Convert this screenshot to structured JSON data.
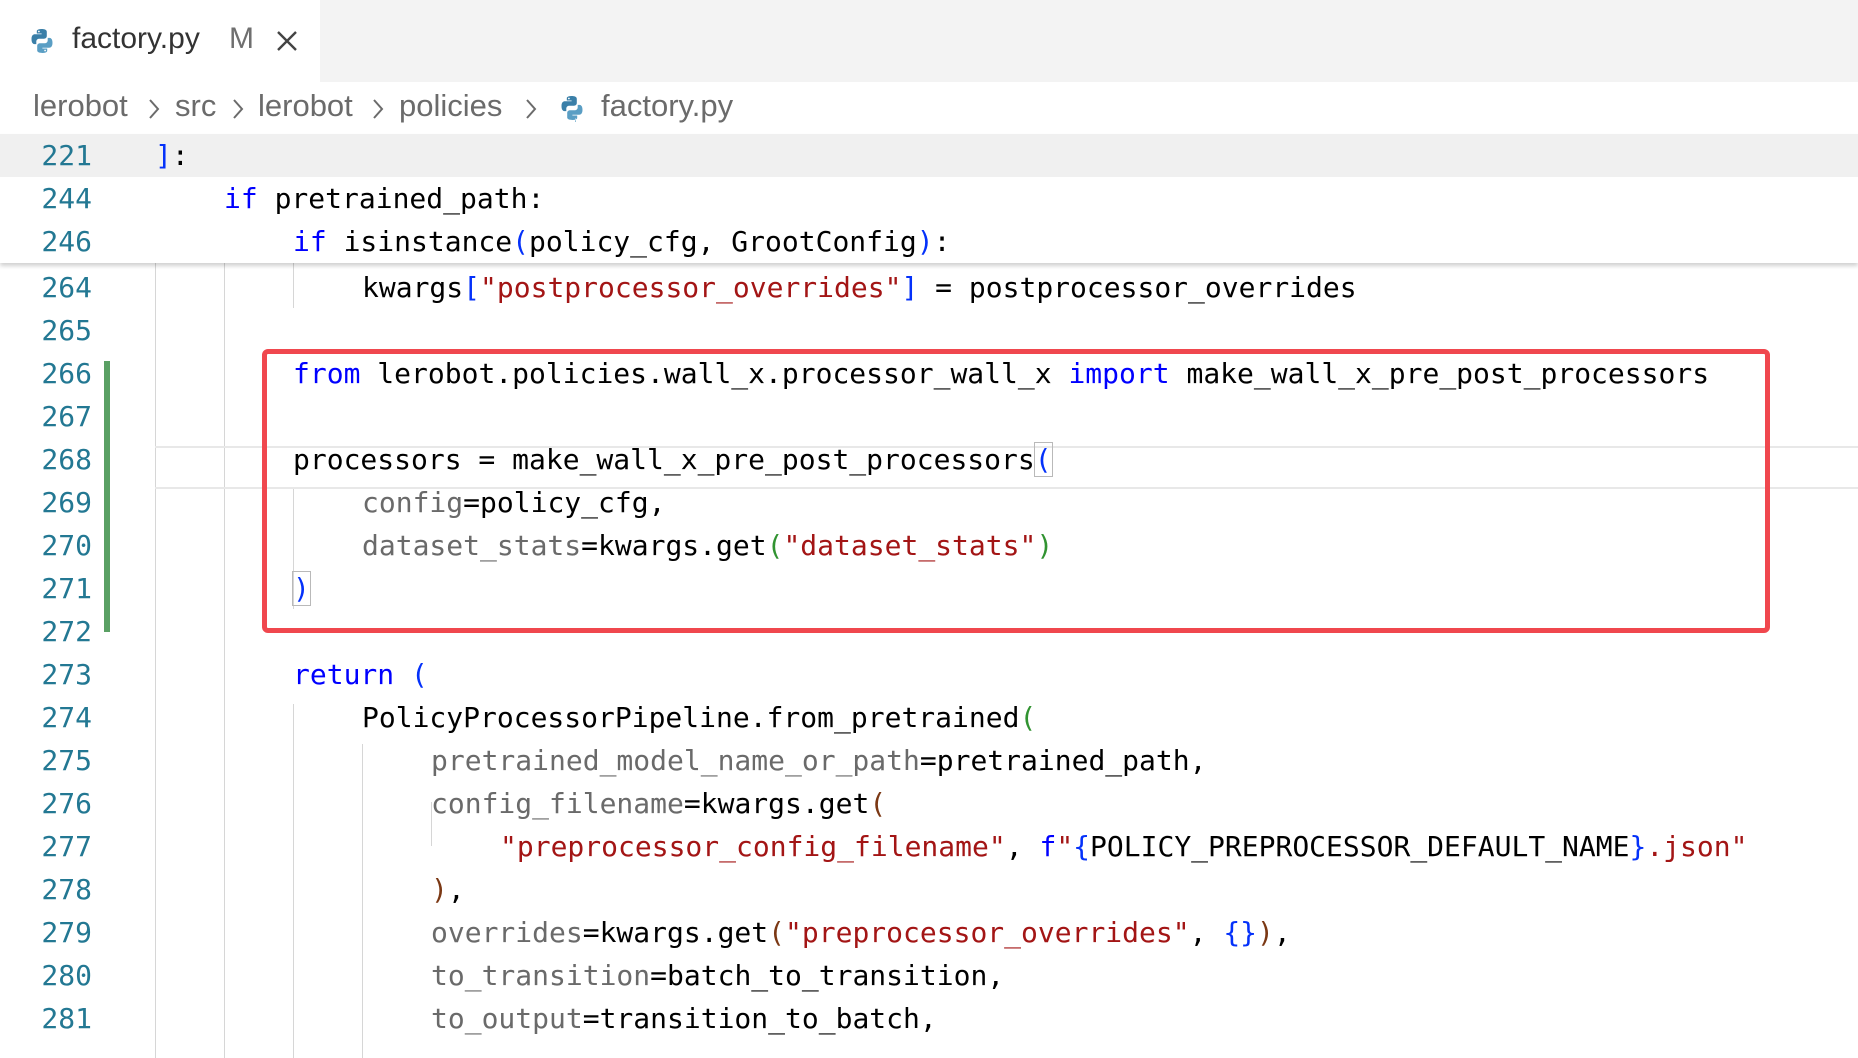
{
  "tab": {
    "filename": "factory.py",
    "status": "M",
    "file_icon": "python-icon",
    "close_icon": "close-icon"
  },
  "breadcrumb": {
    "items": [
      "lerobot",
      "src",
      "lerobot",
      "policies",
      "factory.py"
    ]
  },
  "colors": {
    "line_number": "#237893",
    "keyword": "#0000ff",
    "string": "#a31515",
    "parameter": "#6a6a6a",
    "change_bar": "#5aa064",
    "highlight_box": "#f0474e"
  },
  "editor": {
    "sticky_lines": [
      {
        "num": "221",
        "code": "]:"
      },
      {
        "num": "244",
        "code": "if pretrained_path:"
      },
      {
        "num": "246",
        "code": "if isinstance(policy_cfg, GrootConfig):"
      }
    ],
    "lines": [
      {
        "num": "264",
        "code": "kwargs[\"postprocessor_overrides\"] = postprocessor_overrides"
      },
      {
        "num": "265",
        "code": ""
      },
      {
        "num": "266",
        "code": "from lerobot.policies.wall_x.processor_wall_x import make_wall_x_pre_post_processors"
      },
      {
        "num": "267",
        "code": ""
      },
      {
        "num": "268",
        "code": "processors = make_wall_x_pre_post_processors("
      },
      {
        "num": "269",
        "code": "config=policy_cfg,"
      },
      {
        "num": "270",
        "code": "dataset_stats=kwargs.get(\"dataset_stats\")"
      },
      {
        "num": "271",
        "code": ")"
      },
      {
        "num": "272",
        "code": ""
      },
      {
        "num": "273",
        "code": "return ("
      },
      {
        "num": "274",
        "code": "PolicyProcessorPipeline.from_pretrained("
      },
      {
        "num": "275",
        "code": "pretrained_model_name_or_path=pretrained_path,"
      },
      {
        "num": "276",
        "code": "config_filename=kwargs.get("
      },
      {
        "num": "277",
        "code": "\"preprocessor_config_filename\", f\"{POLICY_PREPROCESSOR_DEFAULT_NAME}.json\""
      },
      {
        "num": "278",
        "code": "),"
      },
      {
        "num": "279",
        "code": "overrides=kwargs.get(\"preprocessor_overrides\", {}),"
      },
      {
        "num": "280",
        "code": "to_transition=batch_to_transition,"
      },
      {
        "num": "281",
        "code": "to_output=transition_to_batch,"
      }
    ]
  }
}
